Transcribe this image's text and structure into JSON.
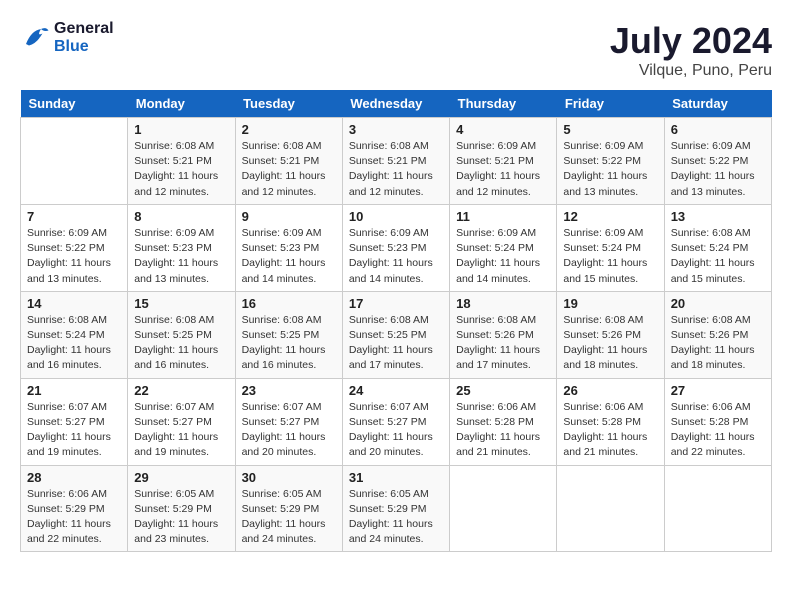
{
  "header": {
    "logo_line1": "General",
    "logo_line2": "Blue",
    "month": "July 2024",
    "location": "Vilque, Puno, Peru"
  },
  "weekdays": [
    "Sunday",
    "Monday",
    "Tuesday",
    "Wednesday",
    "Thursday",
    "Friday",
    "Saturday"
  ],
  "weeks": [
    [
      {
        "day": "",
        "info": ""
      },
      {
        "day": "1",
        "info": "Sunrise: 6:08 AM\nSunset: 5:21 PM\nDaylight: 11 hours and 12 minutes."
      },
      {
        "day": "2",
        "info": "Sunrise: 6:08 AM\nSunset: 5:21 PM\nDaylight: 11 hours and 12 minutes."
      },
      {
        "day": "3",
        "info": "Sunrise: 6:08 AM\nSunset: 5:21 PM\nDaylight: 11 hours and 12 minutes."
      },
      {
        "day": "4",
        "info": "Sunrise: 6:09 AM\nSunset: 5:21 PM\nDaylight: 11 hours and 12 minutes."
      },
      {
        "day": "5",
        "info": "Sunrise: 6:09 AM\nSunset: 5:22 PM\nDaylight: 11 hours and 13 minutes."
      },
      {
        "day": "6",
        "info": "Sunrise: 6:09 AM\nSunset: 5:22 PM\nDaylight: 11 hours and 13 minutes."
      }
    ],
    [
      {
        "day": "7",
        "info": "Sunrise: 6:09 AM\nSunset: 5:22 PM\nDaylight: 11 hours and 13 minutes."
      },
      {
        "day": "8",
        "info": "Sunrise: 6:09 AM\nSunset: 5:23 PM\nDaylight: 11 hours and 13 minutes."
      },
      {
        "day": "9",
        "info": "Sunrise: 6:09 AM\nSunset: 5:23 PM\nDaylight: 11 hours and 14 minutes."
      },
      {
        "day": "10",
        "info": "Sunrise: 6:09 AM\nSunset: 5:23 PM\nDaylight: 11 hours and 14 minutes."
      },
      {
        "day": "11",
        "info": "Sunrise: 6:09 AM\nSunset: 5:24 PM\nDaylight: 11 hours and 14 minutes."
      },
      {
        "day": "12",
        "info": "Sunrise: 6:09 AM\nSunset: 5:24 PM\nDaylight: 11 hours and 15 minutes."
      },
      {
        "day": "13",
        "info": "Sunrise: 6:08 AM\nSunset: 5:24 PM\nDaylight: 11 hours and 15 minutes."
      }
    ],
    [
      {
        "day": "14",
        "info": "Sunrise: 6:08 AM\nSunset: 5:24 PM\nDaylight: 11 hours and 16 minutes."
      },
      {
        "day": "15",
        "info": "Sunrise: 6:08 AM\nSunset: 5:25 PM\nDaylight: 11 hours and 16 minutes."
      },
      {
        "day": "16",
        "info": "Sunrise: 6:08 AM\nSunset: 5:25 PM\nDaylight: 11 hours and 16 minutes."
      },
      {
        "day": "17",
        "info": "Sunrise: 6:08 AM\nSunset: 5:25 PM\nDaylight: 11 hours and 17 minutes."
      },
      {
        "day": "18",
        "info": "Sunrise: 6:08 AM\nSunset: 5:26 PM\nDaylight: 11 hours and 17 minutes."
      },
      {
        "day": "19",
        "info": "Sunrise: 6:08 AM\nSunset: 5:26 PM\nDaylight: 11 hours and 18 minutes."
      },
      {
        "day": "20",
        "info": "Sunrise: 6:08 AM\nSunset: 5:26 PM\nDaylight: 11 hours and 18 minutes."
      }
    ],
    [
      {
        "day": "21",
        "info": "Sunrise: 6:07 AM\nSunset: 5:27 PM\nDaylight: 11 hours and 19 minutes."
      },
      {
        "day": "22",
        "info": "Sunrise: 6:07 AM\nSunset: 5:27 PM\nDaylight: 11 hours and 19 minutes."
      },
      {
        "day": "23",
        "info": "Sunrise: 6:07 AM\nSunset: 5:27 PM\nDaylight: 11 hours and 20 minutes."
      },
      {
        "day": "24",
        "info": "Sunrise: 6:07 AM\nSunset: 5:27 PM\nDaylight: 11 hours and 20 minutes."
      },
      {
        "day": "25",
        "info": "Sunrise: 6:06 AM\nSunset: 5:28 PM\nDaylight: 11 hours and 21 minutes."
      },
      {
        "day": "26",
        "info": "Sunrise: 6:06 AM\nSunset: 5:28 PM\nDaylight: 11 hours and 21 minutes."
      },
      {
        "day": "27",
        "info": "Sunrise: 6:06 AM\nSunset: 5:28 PM\nDaylight: 11 hours and 22 minutes."
      }
    ],
    [
      {
        "day": "28",
        "info": "Sunrise: 6:06 AM\nSunset: 5:29 PM\nDaylight: 11 hours and 22 minutes."
      },
      {
        "day": "29",
        "info": "Sunrise: 6:05 AM\nSunset: 5:29 PM\nDaylight: 11 hours and 23 minutes."
      },
      {
        "day": "30",
        "info": "Sunrise: 6:05 AM\nSunset: 5:29 PM\nDaylight: 11 hours and 24 minutes."
      },
      {
        "day": "31",
        "info": "Sunrise: 6:05 AM\nSunset: 5:29 PM\nDaylight: 11 hours and 24 minutes."
      },
      {
        "day": "",
        "info": ""
      },
      {
        "day": "",
        "info": ""
      },
      {
        "day": "",
        "info": ""
      }
    ]
  ]
}
